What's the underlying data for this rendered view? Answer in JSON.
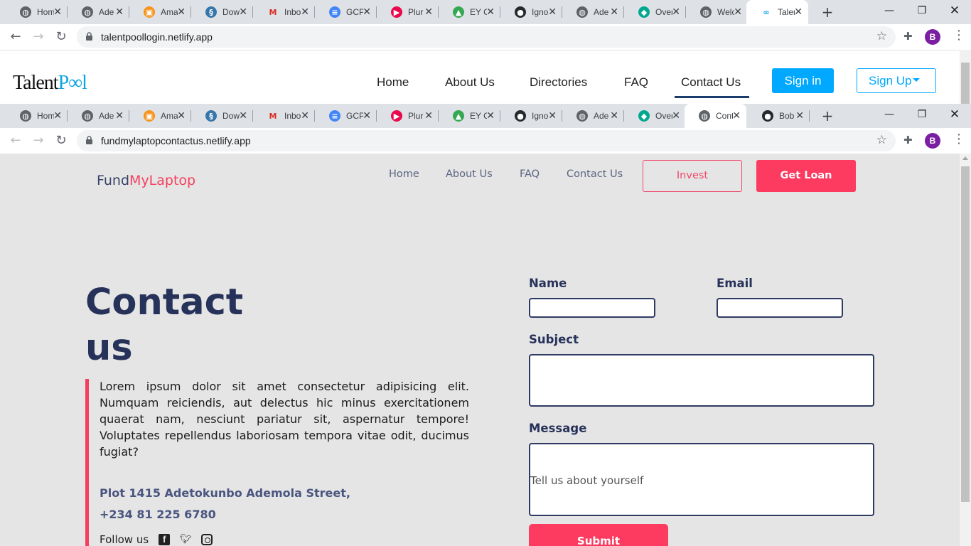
{
  "window1": {
    "tabs": [
      {
        "label": "Hom",
        "icon": "globe-icon",
        "color": "#5f6368"
      },
      {
        "label": "Ade",
        "icon": "globe-icon",
        "color": "#5f6368"
      },
      {
        "label": "Ama",
        "icon": "box-icon",
        "color": "#f7931a"
      },
      {
        "label": "Dow",
        "icon": "python-icon",
        "color": "#3776ab"
      },
      {
        "label": "Inbo",
        "icon": "gmail-icon",
        "color": "#d93025"
      },
      {
        "label": "GCP",
        "icon": "docs-icon",
        "color": "#4285f4"
      },
      {
        "label": "Plur",
        "icon": "pluralsight-icon",
        "color": "#e80a4d"
      },
      {
        "label": "EY C",
        "icon": "drive-icon",
        "color": "#34a853"
      },
      {
        "label": "Igno",
        "icon": "github-icon",
        "color": "#24292e"
      },
      {
        "label": "Ade",
        "icon": "globe-icon",
        "color": "#5f6368"
      },
      {
        "label": "Over",
        "icon": "diamond-icon",
        "color": "#00a88f"
      },
      {
        "label": "Welc",
        "icon": "globe-icon",
        "color": "#5f6368"
      },
      {
        "label": "Taler",
        "icon": "infinity-icon",
        "color": "#0aa3e3"
      }
    ],
    "url": "talentpoollogin.netlify.app",
    "page": {
      "logo_left": "Talent",
      "logo_right": "P∞l",
      "nav": [
        "Home",
        "About Us",
        "Directories",
        "FAQ",
        "Contact Us"
      ],
      "sign_in": "Sign in",
      "sign_up": "Sign Up"
    }
  },
  "window2": {
    "tabs": [
      {
        "label": "Hom",
        "icon": "globe-icon",
        "color": "#5f6368"
      },
      {
        "label": "Ade",
        "icon": "globe-icon",
        "color": "#5f6368"
      },
      {
        "label": "Ama",
        "icon": "box-icon",
        "color": "#f7931a"
      },
      {
        "label": "Dow",
        "icon": "python-icon",
        "color": "#3776ab"
      },
      {
        "label": "Inbo",
        "icon": "gmail-icon",
        "color": "#d93025"
      },
      {
        "label": "GCP",
        "icon": "docs-icon",
        "color": "#4285f4"
      },
      {
        "label": "Plur",
        "icon": "pluralsight-icon",
        "color": "#e80a4d"
      },
      {
        "label": "EY C",
        "icon": "drive-icon",
        "color": "#34a853"
      },
      {
        "label": "Igno",
        "icon": "github-icon",
        "color": "#24292e"
      },
      {
        "label": "Ade",
        "icon": "globe-icon",
        "color": "#5f6368"
      },
      {
        "label": "Over",
        "icon": "diamond-icon",
        "color": "#00a88f"
      },
      {
        "label": "Cont",
        "icon": "globe-icon",
        "color": "#5f6368"
      },
      {
        "label": "Bob",
        "icon": "github-icon",
        "color": "#24292e"
      }
    ],
    "url": "fundmylaptopcontactus.netlify.app",
    "page": {
      "logo_a": "Fund",
      "logo_b": "MyLaptop",
      "nav": [
        "Home",
        "About Us",
        "FAQ",
        "Contact Us"
      ],
      "invest": "Invest",
      "get_loan": "Get Loan",
      "heading_line1": "Contact",
      "heading_line2": "us",
      "body": "Lorem ipsum dolor sit amet consectetur adipisicing elit. Numquam reiciendis, aut delectus hic minus exercitationem quaerat nam, nesciunt pariatur sit, aspernatur tempore! Voluptates repellendus laboriosam tempora vitae odit, ducimus fugiat?",
      "address": "Plot 1415 Adetokunbo Ademola Street,",
      "phone": "+234 81 225 6780",
      "follow_us": "Follow us",
      "form": {
        "name_label": "Name",
        "email_label": "Email",
        "subject_label": "Subject",
        "message_label": "Message",
        "message_placeholder": "Tell us about yourself",
        "submit": "Submit"
      }
    }
  },
  "profile_initial": "B",
  "accent_color": "#fd3a60",
  "brand_blue": "#00a8ff"
}
